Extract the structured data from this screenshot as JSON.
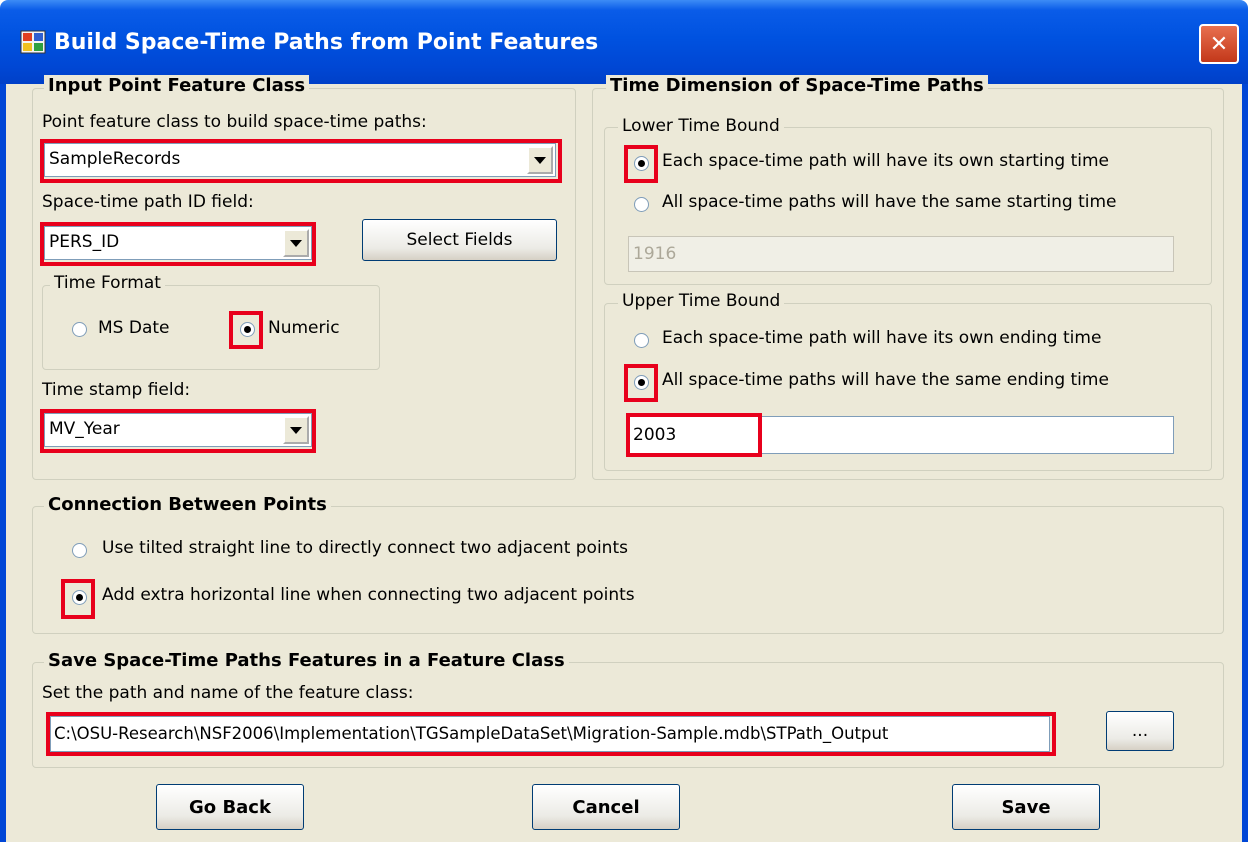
{
  "window": {
    "title": "Build Space-Time Paths from Point Features",
    "close_label": "✕"
  },
  "input_group": {
    "legend": "Input Point Feature Class",
    "feature_class_label": "Point feature class to build space-time paths:",
    "feature_class_value": "SampleRecords",
    "id_field_label": "Space-time path ID field:",
    "id_field_value": "PERS_ID",
    "select_fields_button": "Select Fields",
    "time_format": {
      "legend": "Time Format",
      "ms_date": "MS Date",
      "numeric": "Numeric",
      "selected": "Numeric"
    },
    "time_stamp_label": "Time stamp field:",
    "time_stamp_value": "MV_Year"
  },
  "time_dimension": {
    "legend": "Time Dimension of Space-Time Paths",
    "lower": {
      "legend": "Lower Time Bound",
      "own_start": "Each space-time path will have its own starting time",
      "same_start": "All space-time paths will have the same starting time",
      "start_value": "1916",
      "selected": "own_start"
    },
    "upper": {
      "legend": "Upper Time Bound",
      "own_end": "Each space-time path will have its own ending time",
      "same_end": "All space-time paths will have the same ending time",
      "end_value": "2003",
      "selected": "same_end"
    }
  },
  "connection": {
    "legend": "Connection Between Points",
    "tilted": "Use tilted straight line to directly connect two adjacent points",
    "horizontal": "Add extra horizontal line when connecting two adjacent points",
    "selected": "horizontal"
  },
  "save_group": {
    "legend": "Save Space-Time Paths Features in a Feature Class",
    "path_label": "Set the path and name of the feature class:",
    "path_value": "C:\\OSU-Research\\NSF2006\\Implementation\\TGSampleDataSet\\Migration-Sample.mdb\\STPath_Output",
    "browse_button": "..."
  },
  "buttons": {
    "go_back": "Go Back",
    "cancel": "Cancel",
    "save": "Save"
  },
  "colors": {
    "titlebar": "#0052e0",
    "dialog_bg": "#ece9d8",
    "highlight": "#e8001c",
    "close": "#c3381a"
  }
}
